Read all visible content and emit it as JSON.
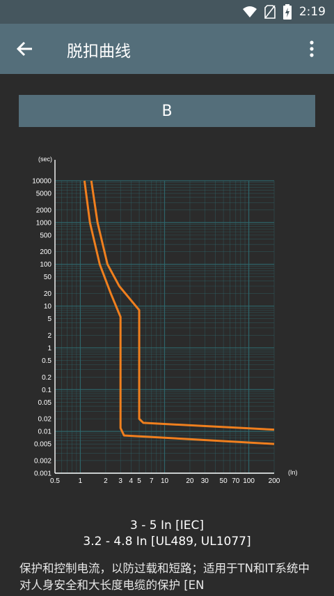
{
  "status": {
    "time": "2:19"
  },
  "app": {
    "title": "脱扣曲线"
  },
  "curve_selector": {
    "label": "B"
  },
  "chart_data": {
    "type": "line",
    "title": "",
    "xlabel": "(In)",
    "ylabel": "(sec)",
    "x_scale": "log",
    "y_scale": "log",
    "xlim": [
      0.5,
      200
    ],
    "ylim": [
      0.001,
      10000
    ],
    "x_ticks": [
      "0.5",
      "1",
      "2",
      "3",
      "4",
      "5",
      "7",
      "10",
      "20",
      "30",
      "50",
      "70",
      "100",
      "200"
    ],
    "y_ticks": [
      "10000",
      "5000",
      "2000",
      "1000",
      "500",
      "200",
      "100",
      "50",
      "20",
      "10",
      "5",
      "2",
      "1",
      "0.5",
      "0.2",
      "0.1",
      "0.05",
      "0.02",
      "0.01",
      "0.005",
      "0.002",
      "0.001"
    ],
    "grid": true,
    "colors": {
      "curve": "#f07f1e",
      "grid": "#2f6b70",
      "axis": "#ffffff"
    },
    "series": [
      {
        "values": [
          [
            1.12,
            10000
          ],
          [
            1.3,
            1000
          ],
          [
            1.7,
            100
          ],
          [
            2.3,
            20
          ],
          [
            3,
            5.5
          ],
          [
            3,
            0.012
          ],
          [
            3.3,
            0.008
          ],
          [
            200,
            0.005
          ]
        ]
      },
      {
        "values": [
          [
            1.35,
            10000
          ],
          [
            1.6,
            1000
          ],
          [
            2.1,
            100
          ],
          [
            2.9,
            30
          ],
          [
            5,
            8
          ],
          [
            5,
            0.02
          ],
          [
            5.6,
            0.016
          ],
          [
            200,
            0.011
          ]
        ]
      }
    ]
  },
  "rating": {
    "line1": "3 - 5 In  [IEC]",
    "line2": "3.2 - 4.8 In  [UL489, UL1077]"
  },
  "description": "保护和控制电流，以防过载和短路；适用于TN和IT系统中对人身安全和大长度电缆的保护 [EN"
}
